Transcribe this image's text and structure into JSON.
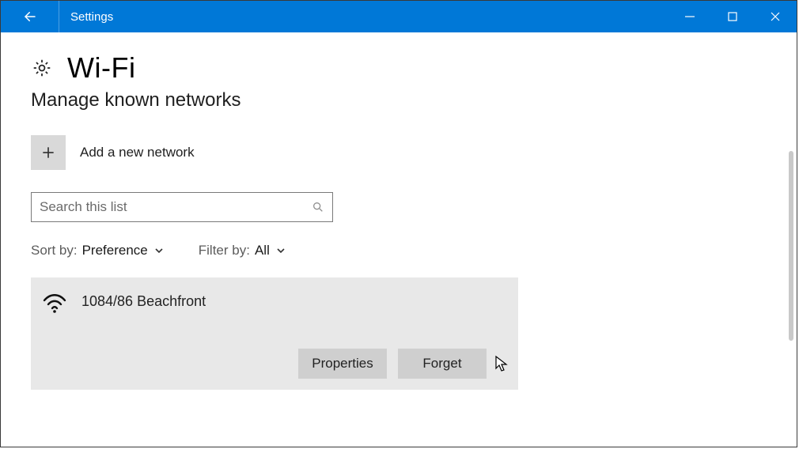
{
  "titlebar": {
    "title": "Settings"
  },
  "page": {
    "title": "Wi-Fi",
    "subtitle": "Manage known networks"
  },
  "add": {
    "label": "Add a new network"
  },
  "search": {
    "placeholder": "Search this list"
  },
  "sort": {
    "label": "Sort by:",
    "value": "Preference"
  },
  "filter": {
    "label": "Filter by:",
    "value": "All"
  },
  "network": {
    "name": "1084/86 Beachfront",
    "properties_label": "Properties",
    "forget_label": "Forget"
  }
}
